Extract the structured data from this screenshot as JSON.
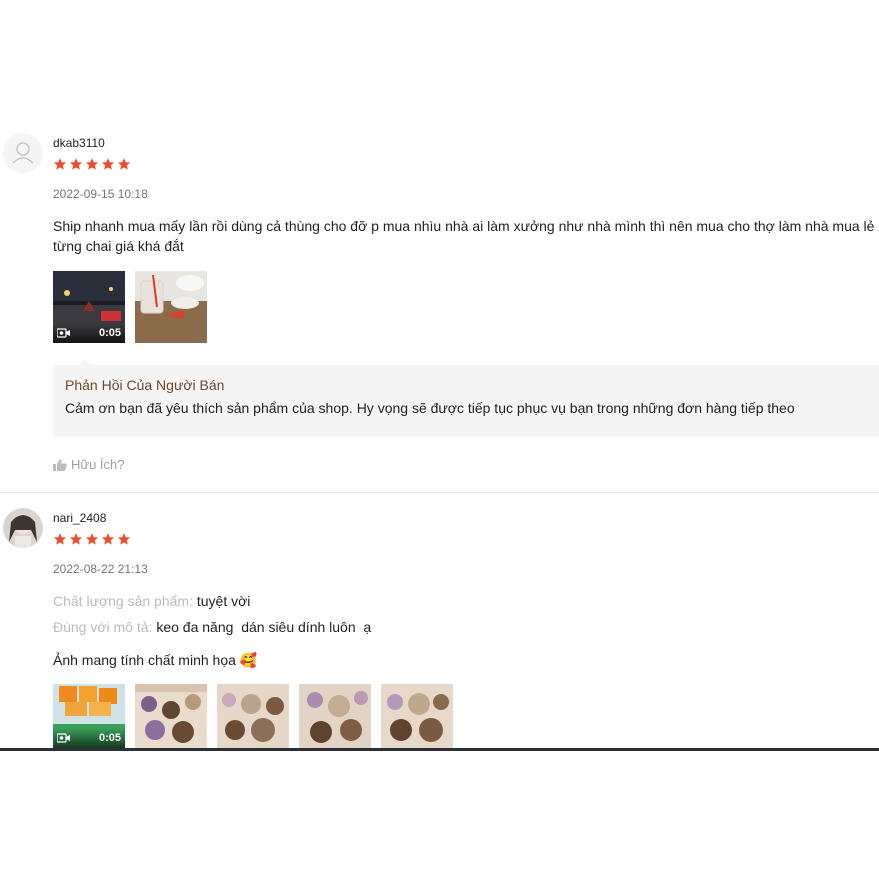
{
  "reviews": [
    {
      "username": "dkab3110",
      "rating": 5,
      "timestamp": "2022-09-15 10:18",
      "content": "Ship nhanh mua mấy lần rồi dùng cả thùng cho đỡ p mua nhìu nhà ai làm xưởng như nhà mình thì nên mua cho thợ làm nhà mua lẻ từng chai giá khá đắt",
      "media": [
        {
          "type": "video",
          "duration": "0:05"
        },
        {
          "type": "image"
        }
      ],
      "seller_reply": {
        "title": "Phản Hồi Của Người Bán",
        "text": "Cảm ơn bạn đã yêu thích sản phẩm của shop. Hy vọng sẽ được tiếp tục phục vụ bạn trong những đơn hàng tiếp theo"
      },
      "helpful_label": "Hữu Ích?"
    },
    {
      "username": "nari_2408",
      "rating": 5,
      "timestamp": "2022-08-22 21:13",
      "attributes": [
        {
          "label": "Chất lượng sản phẩm:",
          "value": "tuyệt vời"
        },
        {
          "label": "Đúng với mô tả:",
          "value": "keo đa năng  dán siêu dính luôn  ạ"
        }
      ],
      "content": "Ảnh mang tính chất minh họa 🥰",
      "media": [
        {
          "type": "video",
          "duration": "0:05"
        },
        {
          "type": "image"
        },
        {
          "type": "image"
        },
        {
          "type": "image"
        },
        {
          "type": "image"
        }
      ]
    }
  ],
  "colors": {
    "star": "#ee4d2d",
    "seller_title": "#6b4a2a",
    "muted": "#757575"
  }
}
